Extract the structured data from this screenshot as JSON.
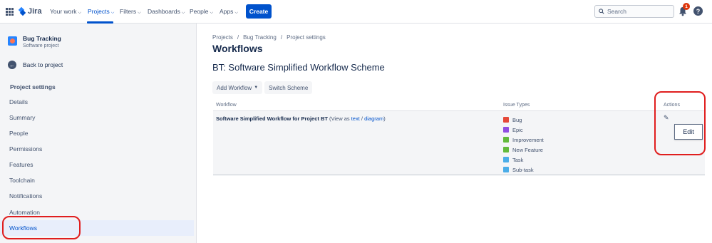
{
  "topnav": {
    "logo_text": "Jira",
    "items": [
      {
        "label": "Your work"
      },
      {
        "label": "Projects"
      },
      {
        "label": "Filters"
      },
      {
        "label": "Dashboards"
      },
      {
        "label": "People"
      },
      {
        "label": "Apps"
      }
    ],
    "active_item": "Projects",
    "create_label": "Create",
    "search_placeholder": "Search",
    "notification_count": "1",
    "help_glyph": "?"
  },
  "sidebar": {
    "project_name": "Bug Tracking",
    "project_type": "Software project",
    "back_label": "Back to project",
    "section_title": "Project settings",
    "items": [
      {
        "label": "Details"
      },
      {
        "label": "Summary"
      },
      {
        "label": "People"
      },
      {
        "label": "Permissions"
      },
      {
        "label": "Features"
      },
      {
        "label": "Toolchain"
      },
      {
        "label": "Notifications"
      },
      {
        "label": "Automation"
      },
      {
        "label": "Workflows"
      }
    ],
    "selected_item": "Workflows"
  },
  "main": {
    "breadcrumb": [
      "Projects",
      "Bug Tracking",
      "Project settings"
    ],
    "breadcrumb_separator": "/",
    "title": "Workflows",
    "scheme_title": "BT: Software Simplified Workflow Scheme",
    "add_workflow_label": "Add Workflow",
    "switch_scheme_label": "Switch Scheme",
    "table": {
      "headers": {
        "workflow": "Workflow",
        "issue_types": "Issue Types",
        "actions": "Actions"
      },
      "row": {
        "workflow_name": "Software Simplified Workflow for Project BT",
        "view_prefix": "(View as",
        "view_text_link": "text",
        "view_separator": "/",
        "view_diagram_link": "diagram",
        "view_suffix": ")",
        "issue_types": [
          {
            "label": "Bug",
            "color": "#e5493a",
            "icon": "bug-icon"
          },
          {
            "label": "Epic",
            "color": "#904ee2",
            "icon": "epic-icon"
          },
          {
            "label": "Improvement",
            "color": "#63ba3c",
            "icon": "improvement-icon"
          },
          {
            "label": "New Feature",
            "color": "#63ba3c",
            "icon": "new-feature-icon"
          },
          {
            "label": "Task",
            "color": "#4bade8",
            "icon": "task-icon"
          },
          {
            "label": "Sub-task",
            "color": "#4bade8",
            "icon": "subtask-icon"
          }
        ],
        "edit_tooltip": "Edit"
      }
    }
  },
  "colors": {
    "accent": "#0052cc",
    "annotation_red": "#e01e1e",
    "sidebar_bg": "#f4f5f7"
  }
}
